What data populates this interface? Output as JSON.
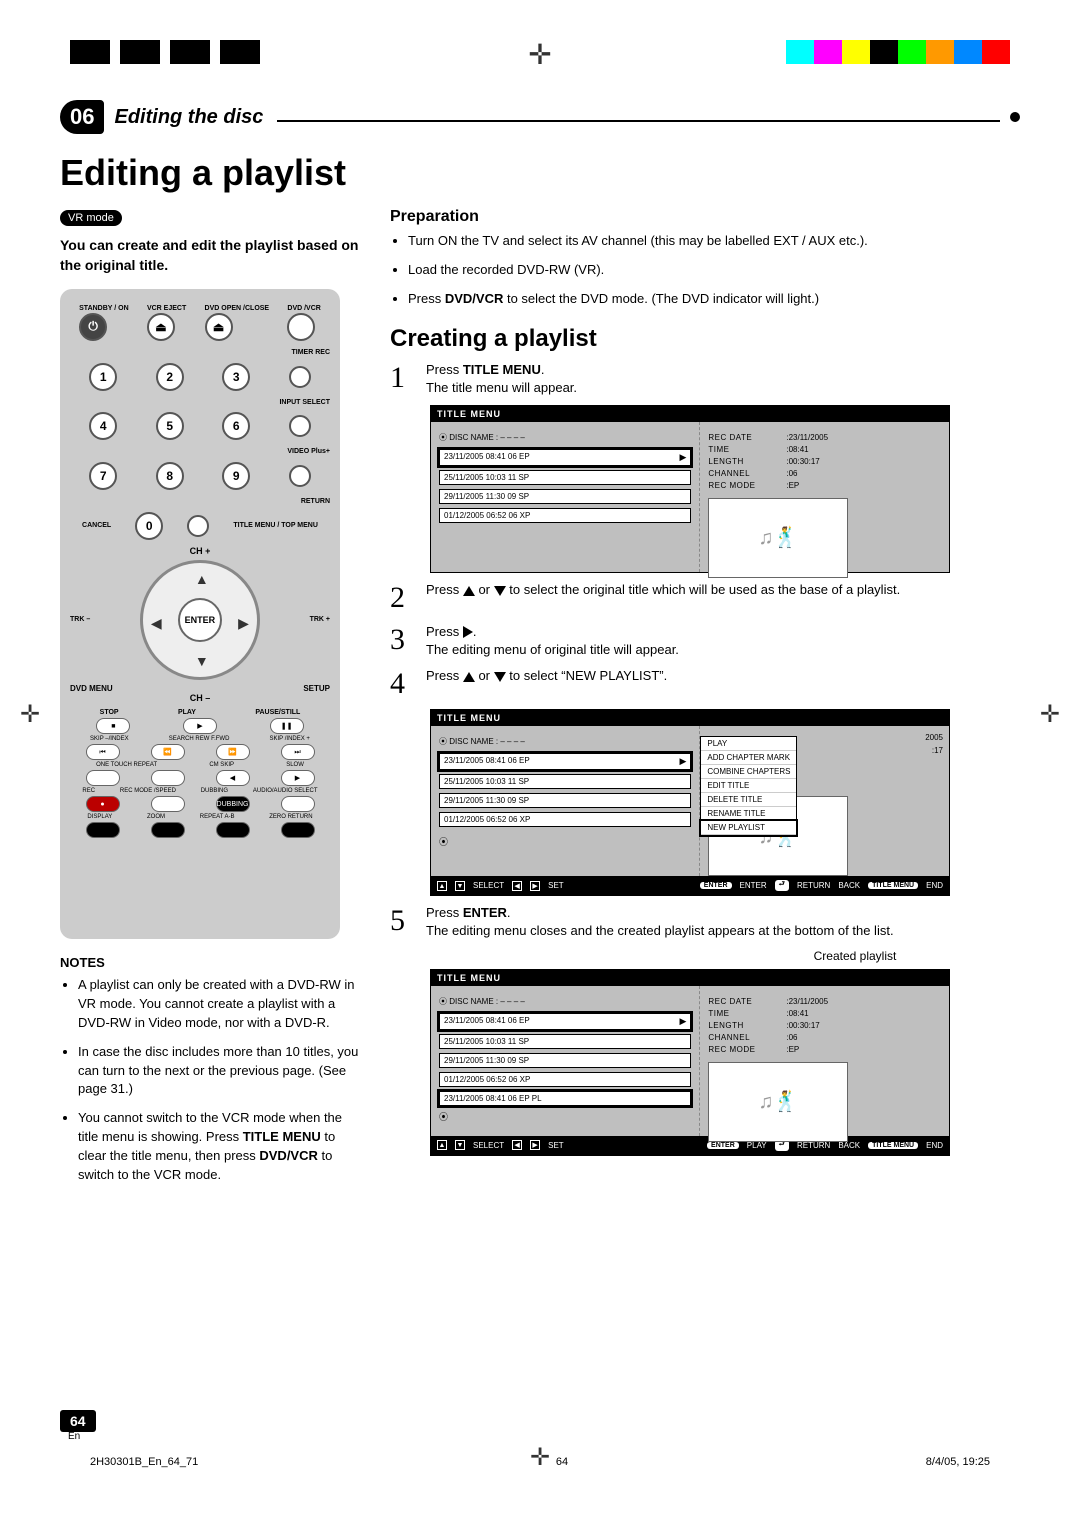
{
  "chapter": {
    "number": "06",
    "title": "Editing the disc"
  },
  "page": {
    "title": "Editing a playlist",
    "vr_badge": "VR mode",
    "intro": "You can create and edit the playlist based on the original title.",
    "number": "64",
    "lang": "En",
    "footer_left": "2H30301B_En_64_71",
    "footer_mid": "64",
    "footer_right": "8/4/05, 19:25"
  },
  "remote": {
    "top_labels": [
      "STANDBY / ON",
      "VCR EJECT",
      "DVD OPEN /CLOSE",
      "DVD /VCR"
    ],
    "right_labels": [
      "TIMER REC",
      "INPUT SELECT",
      "VIDEO Plus+",
      "RETURN",
      "TITLE MENU / TOP MENU",
      "SETUP"
    ],
    "left_labels": [
      "CANCEL",
      "DVD MENU"
    ],
    "dpad_center": "ENTER",
    "ch_plus": "CH +",
    "ch_minus": "CH –",
    "trk_minus": "TRK –",
    "trk_plus": "TRK +",
    "transport_top": [
      "STOP",
      "PLAY",
      "PAUSE/STILL"
    ],
    "transport_mid": [
      "SKIP –/INDEX",
      "SEARCH REW  F.FWD",
      "SKIP /INDEX +"
    ],
    "row_misc": [
      "ONE TOUCH REPEAT",
      "CM SKIP",
      "SLOW"
    ],
    "row_rec": [
      "REC",
      "REC MODE /SPEED",
      "DUBBING",
      "AUDIO/AUDIO SELECT"
    ],
    "row_last": [
      "DISPLAY",
      "ZOOM",
      "REPEAT A-B",
      "ZERO RETURN"
    ]
  },
  "notes": {
    "heading": "NOTES",
    "items": [
      "A playlist can only be created with a DVD-RW in VR mode. You cannot create a playlist with a DVD-RW in Video mode, nor with a DVD-R.",
      "In case the disc includes more than 10 titles, you can turn to the next or the previous page. (See page 31.)",
      "You cannot switch to the VCR mode when the title menu is showing. Press TITLE MENU to clear the title menu, then press DVD/VCR to switch to the VCR mode."
    ],
    "bold_keys": [
      "TITLE MENU",
      "DVD/VCR"
    ]
  },
  "prep": {
    "heading": "Preparation",
    "items": [
      "Turn ON the TV and select its AV channel (this may be labelled EXT / AUX etc.).",
      "Load the recorded DVD-RW (VR).",
      "Press DVD/VCR to select the DVD mode. (The DVD indicator will light.)"
    ],
    "bold_key": "DVD/VCR"
  },
  "creating": {
    "heading": "Creating a playlist",
    "step1a": "Press ",
    "step1key": "TITLE MENU",
    "step1b": ".",
    "step1c": "The title menu will appear.",
    "step2": "Press   or   to select the original title which will be used as the base of a playlist.",
    "step3a": "Press  .",
    "step3b": "The editing menu of original title will appear.",
    "step4": "Press   or   to select “NEW PLAYLIST”.",
    "step5a": "Press ",
    "step5key": "ENTER",
    "step5b": ".",
    "step5c": "The editing menu closes and the created playlist appears at the bottom of the list.",
    "created_label": "Created playlist"
  },
  "screen": {
    "header": "TITLE MENU",
    "disc_name": "DISC NAME : – – – –",
    "entries": [
      "23/11/2005 08:41 06 EP",
      "25/11/2005 10:03 11 SP",
      "29/11/2005 11:30 09 SP",
      "01/12/2005 06:52 06 XP"
    ],
    "entry_playlist": "23/11/2005 08:41 06 EP PL",
    "info": {
      "REC DATE": ":23/11/2005",
      "TIME": ":08:41",
      "LENGTH": ":00:30:17",
      "CHANNEL": ":06",
      "REC MODE": ":EP"
    },
    "info_short": {
      "extra1": "2005",
      "extra2": ":17"
    },
    "popup": [
      "PLAY",
      "ADD CHAPTER MARK",
      "COMBINE CHAPTERS",
      "EDIT TITLE",
      "DELETE TITLE",
      "RENAME TITLE",
      "NEW PLAYLIST"
    ],
    "footer": {
      "select": "SELECT",
      "set": "SET",
      "keys": {
        "enter1": "ENTER",
        "enter2": "ENTER",
        "play": "PLAY",
        "ret": "RETURN",
        "back": "BACK",
        "menu": "TITLE MENU",
        "end": "END"
      }
    }
  }
}
